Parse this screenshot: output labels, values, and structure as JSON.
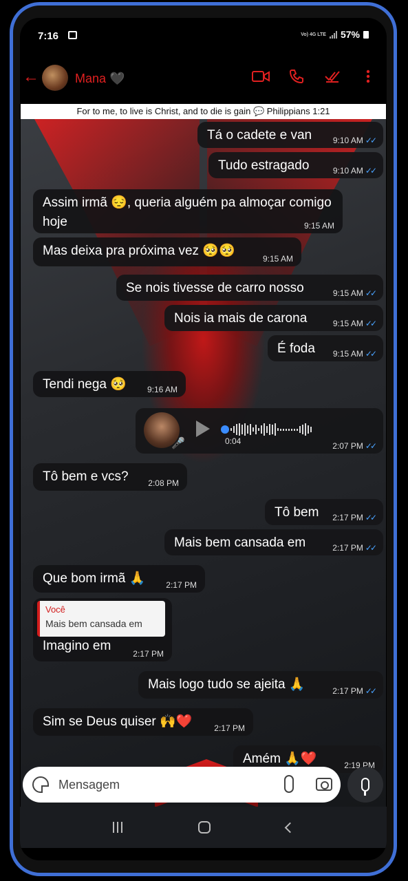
{
  "status_bar": {
    "time": "7:16",
    "network": "Vo) 4G LTE",
    "battery": "57%"
  },
  "header": {
    "contact_name": "Mana 🖤"
  },
  "banner": {
    "text": "For to me, to live is Christ, and to die is gain 💬 Philippians 1:21"
  },
  "messages": [
    {
      "dir": "out",
      "text": "Tá o cadete e van",
      "time": "9:10 AM"
    },
    {
      "dir": "out",
      "text": "Tudo estragado",
      "time": "9:10 AM"
    },
    {
      "dir": "in",
      "text": "Assim irmã 😔, queria alguém pa almoçar comigo hoje",
      "time": "9:15 AM"
    },
    {
      "dir": "in",
      "text": "Mas deixa pra próxima vez 🥺🥺",
      "time": "9:15 AM"
    },
    {
      "dir": "out",
      "text": "Se nois tivesse de carro nosso",
      "time": "9:15 AM"
    },
    {
      "dir": "out",
      "text": "Nois ia mais de carona",
      "time": "9:15 AM"
    },
    {
      "dir": "out",
      "text": "É foda",
      "time": "9:15 AM"
    },
    {
      "dir": "in",
      "text": "Tendi nega 🥺",
      "time": "9:16 AM"
    },
    {
      "dir": "out",
      "type": "voice",
      "duration": "0:04",
      "time": "2:07 PM"
    },
    {
      "dir": "in",
      "text": "Tô bem e vcs?",
      "time": "2:08 PM"
    },
    {
      "dir": "out",
      "text": "Tô bem",
      "time": "2:17 PM"
    },
    {
      "dir": "out",
      "text": "Mais bem cansada em",
      "time": "2:17 PM"
    },
    {
      "dir": "in",
      "text": "Que bom irmã 🙏",
      "time": "2:17 PM"
    },
    {
      "dir": "in",
      "text": "Imagino em",
      "time": "2:17 PM",
      "quote_author": "Você",
      "quote_text": "Mais bem cansada em"
    },
    {
      "dir": "out",
      "text": "Mais logo tudo se ajeita 🙏",
      "time": "2:17 PM"
    },
    {
      "dir": "in",
      "text": "Sim se Deus quiser 🙌❤️",
      "time": "2:17 PM"
    },
    {
      "dir": "out",
      "text": "Amém 🙏❤️",
      "time": "2:19 PM"
    }
  ],
  "read_ticks": "✓✓",
  "input": {
    "placeholder": "Mensagem"
  },
  "colors": {
    "accent": "#e02020",
    "read_receipt": "#4aa3ff",
    "frame": "#3f6fd6"
  }
}
